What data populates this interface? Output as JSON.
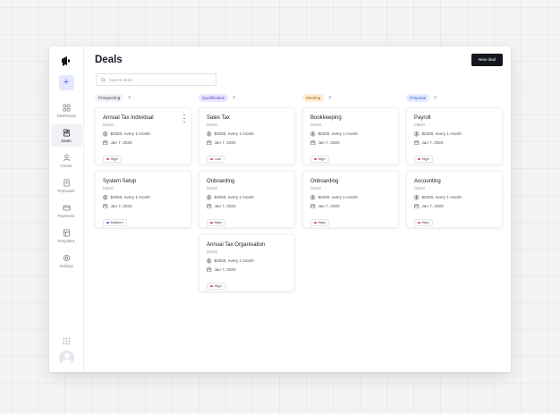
{
  "page": {
    "title": "Deals",
    "new_deal_label": "New deal"
  },
  "search": {
    "placeholder": "Search deals",
    "value": ""
  },
  "sidebar": {
    "add_label": "+",
    "items": [
      {
        "label": "Dashboard",
        "icon": "dashboard-icon",
        "active": false
      },
      {
        "label": "Deals",
        "icon": "deals-icon",
        "active": true
      },
      {
        "label": "Clients",
        "icon": "clients-icon",
        "active": false
      },
      {
        "label": "Proposals",
        "icon": "proposals-icon",
        "active": false
      },
      {
        "label": "Payments",
        "icon": "payments-icon",
        "active": false
      },
      {
        "label": "Templates",
        "icon": "templates-icon",
        "active": false
      },
      {
        "label": "Settings",
        "icon": "gear-icon",
        "active": false
      }
    ]
  },
  "columns": [
    {
      "name": "Prospecting",
      "count": "2",
      "cards": [
        {
          "title": "Annual Tax Individual",
          "subtitle": "Client",
          "amount": "$2000, every 1 month",
          "date": "Jan 7, 2020",
          "priority": "High"
        },
        {
          "title": "System Setup",
          "subtitle": "Client",
          "amount": "$2000, every 1 month",
          "date": "Jan 7, 2020",
          "priority": "Medium"
        }
      ]
    },
    {
      "name": "Qualification",
      "count": "3",
      "cards": [
        {
          "title": "Sales Tax",
          "subtitle": "Client",
          "amount": "$2000, every 1 month",
          "date": "Jan 7, 2020",
          "priority": "Low"
        },
        {
          "title": "Onboarding",
          "subtitle": "Client",
          "amount": "$2000, every 1 month",
          "date": "Jan 7, 2020",
          "priority": "High"
        },
        {
          "title": "Annual Tax Organisation",
          "subtitle": "Client",
          "amount": "$2000, every 1 month",
          "date": "Jan 7, 2020",
          "priority": "High"
        }
      ]
    },
    {
      "name": "Meeting",
      "count": "2",
      "cards": [
        {
          "title": "Bookkeeping",
          "subtitle": "Client",
          "amount": "$2000, every 1 month",
          "date": "Jan 7, 2020",
          "priority": "High"
        },
        {
          "title": "Onboarding",
          "subtitle": "Client",
          "amount": "$2000, every 1 month",
          "date": "Jan 7, 2020",
          "priority": "High"
        }
      ]
    },
    {
      "name": "Proposal",
      "count": "2",
      "cards": [
        {
          "title": "Payroll",
          "subtitle": "Client",
          "amount": "$2000, every 1 month",
          "date": "Jan 7, 2020",
          "priority": "High"
        },
        {
          "title": "Accounting",
          "subtitle": "Client",
          "amount": "$2000, every 1 month",
          "date": "Jan 7, 2020",
          "priority": "High"
        }
      ]
    }
  ],
  "colors": {
    "prospecting_pill_bg": "#f0f1f4",
    "prospecting_pill_fg": "#3c4050",
    "qualification_pill_bg": "#ece6ff",
    "qualification_pill_fg": "#5b45c9",
    "meeting_pill_bg": "#ffedd6",
    "meeting_pill_fg": "#a8621a",
    "proposal_pill_bg": "#e2ecff",
    "proposal_pill_fg": "#3d63c9",
    "priority_high": "#e5484d",
    "priority_medium": "#3e63dd",
    "priority_low": "#e5484d"
  }
}
